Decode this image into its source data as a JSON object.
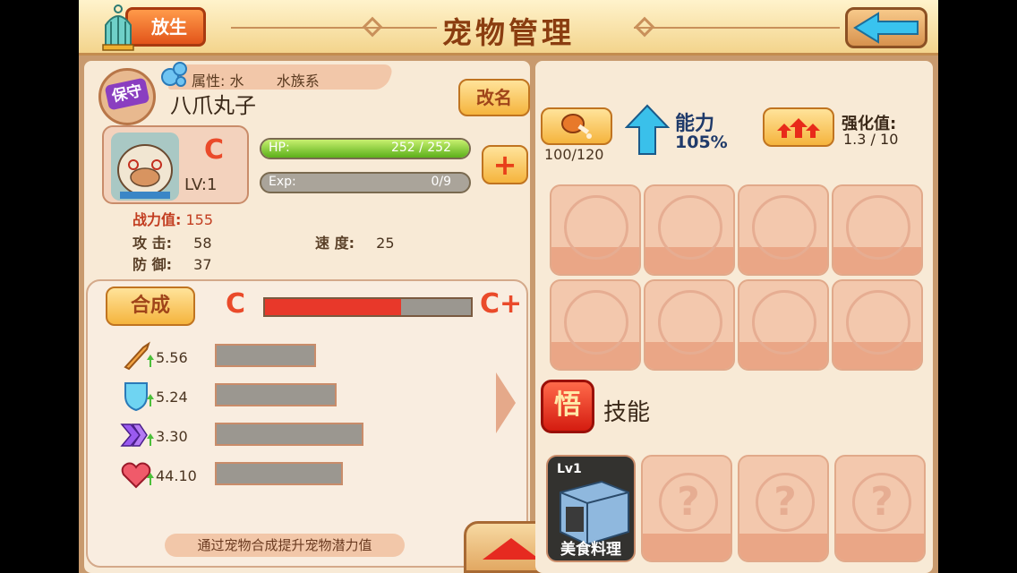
{
  "header": {
    "title": "宠物管理",
    "release_label": "放生"
  },
  "pet": {
    "badge": "保守",
    "attribute_prefix": "属性:",
    "attribute_value": "水",
    "attribute_family": "水族系",
    "name": "八爪丸子",
    "rename_label": "改名",
    "grade": "C",
    "level": "LV:1",
    "hp_label": "HP:",
    "hp_text": "252 / 252",
    "hp_fraction": 1.0,
    "exp_label": "Exp:",
    "exp_text": "0/9",
    "exp_fraction": 0.0,
    "plus_label": "+",
    "power_label": "战力值:",
    "power_value": "155",
    "attack_label": "攻 击:",
    "attack_value": "58",
    "defense_label": "防 御:",
    "defense_value": "37",
    "speed_label": "速 度:",
    "speed_value": "25"
  },
  "synthesis": {
    "button_label": "合成",
    "grade_from": "C",
    "grade_to": "C+",
    "progress_fraction": 0.66,
    "attributes": [
      {
        "icon": "sword-up-icon",
        "value": "5.56",
        "fill": 0.49
      },
      {
        "icon": "shield-up-icon",
        "value": "5.24",
        "fill": 0.59
      },
      {
        "icon": "speed-chevron-up-icon",
        "value": "3.30",
        "fill": 0.72
      },
      {
        "icon": "heart-up-icon",
        "value": "44.10",
        "fill": 0.62
      }
    ],
    "hint": "通过宠物合成提升宠物潜力值"
  },
  "abilities": {
    "food_text": "100/120",
    "ability_label": "能力",
    "ability_value": "105%",
    "enhance_label": "强化值:",
    "enhance_value": "1.3 / 10"
  },
  "equipment_slots": [
    "paw-emblem-icon",
    "claw-emblem-icon",
    "wing-emblem-icon",
    "tag-emblem-icon",
    "monster-emblem-icon",
    "beast-emblem-icon",
    "pig-emblem-icon",
    "dragon-emblem-icon"
  ],
  "skills": {
    "wu_label": "悟",
    "label": "技能",
    "learned": {
      "level": "Lv1",
      "name": "美食料理"
    },
    "empty_mark": "?"
  },
  "colors": {
    "accent_red": "#ea4a2a",
    "hp_green": "#5cb01a",
    "panel": "#f8ead6"
  }
}
